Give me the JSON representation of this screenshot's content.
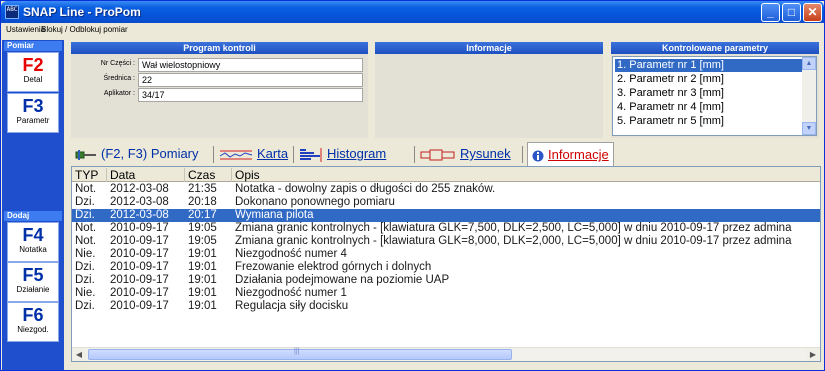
{
  "window": {
    "app_icon": "ABC",
    "title": "SNAP Line - ProPom",
    "min": "_",
    "max": "□",
    "close": "✕"
  },
  "menu": {
    "item1": "Ustawienia",
    "item2": "Blokuj / Odblokuj pomiar"
  },
  "sidebar": {
    "group1": "Pomiar",
    "group2": "Dodaj",
    "keys": [
      {
        "key": "F2",
        "label": "Detal"
      },
      {
        "key": "F3",
        "label": "Parametr"
      },
      {
        "key": "F4",
        "label": "Notatka"
      },
      {
        "key": "F5",
        "label": "Działanie"
      },
      {
        "key": "F6",
        "label": "Niezgod."
      }
    ]
  },
  "program": {
    "title": "Program kontroli",
    "fields": [
      {
        "label": "Nr Części :",
        "value": "Wał wielostopniowy"
      },
      {
        "label": "Średnica :",
        "value": "22"
      },
      {
        "label": "Aplikator :",
        "value": "34/17"
      }
    ]
  },
  "info": {
    "title": "Informacje"
  },
  "params": {
    "title": "Kontrolowane parametry",
    "items": [
      "1. Parametr nr 1 [mm]",
      "2. Parametr nr 2 [mm]",
      "3. Parametr nr 3 [mm]",
      "4. Parametr nr 4 [mm]",
      "5. Parametr nr 5 [mm]"
    ],
    "up": "▲",
    "down": "▼"
  },
  "tabs": {
    "pomiary": "(F2, F3) Pomiary",
    "karta": "Karta",
    "histogram": "Histogram",
    "rysunek": "Rysunek",
    "informacje": "Informacje"
  },
  "table": {
    "headers": [
      "TYP",
      "Data",
      "Czas",
      "Opis"
    ],
    "rows": [
      [
        "Not.",
        "2012-03-08",
        "21:35",
        "Notatka - dowolny zapis o długości do 255 znaków."
      ],
      [
        "Dzi.",
        "2012-03-08",
        "20:18",
        "Dokonano ponownego pomiaru"
      ],
      [
        "Dzi.",
        "2012-03-08",
        "20:17",
        "Wymiana pilota"
      ],
      [
        "Not.",
        "2010-09-17",
        "19:05",
        "Zmiana granic kontrolnych - [klawiatura GLK=7,500, DLK=2,500, LC=5,000] w dniu 2010-09-17 przez admina"
      ],
      [
        "Not.",
        "2010-09-17",
        "19:05",
        "Zmiana granic kontrolnych - [klawiatura GLK=8,000, DLK=2,000, LC=5,000] w dniu 2010-09-17 przez admina"
      ],
      [
        "Nie.",
        "2010-09-17",
        "19:01",
        "Niezgodność numer 4"
      ],
      [
        "Dzi.",
        "2010-09-17",
        "19:01",
        "Frezowanie elektrod górnych i dolnych"
      ],
      [
        "Dzi.",
        "2010-09-17",
        "19:01",
        "Działania podejmowane na poziomie UAP"
      ],
      [
        "Nie.",
        "2010-09-17",
        "19:01",
        "Niezgodność numer 1"
      ],
      [
        "Dzi.",
        "2010-09-17",
        "19:01",
        "Regulacja siły docisku"
      ]
    ],
    "selected_row": 2
  },
  "scroll": {
    "left": "◀",
    "right": "▶",
    "grip": "|||"
  }
}
